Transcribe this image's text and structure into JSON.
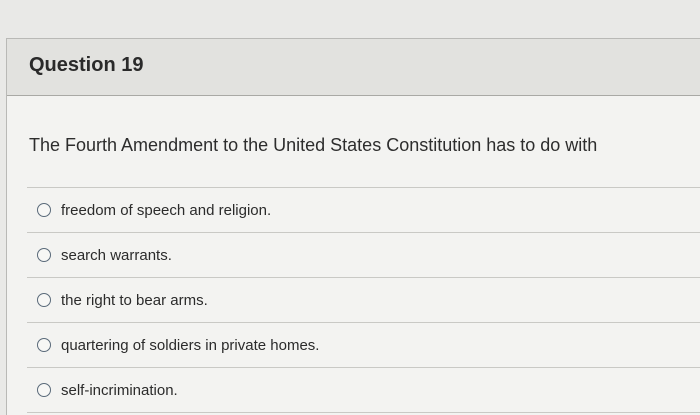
{
  "question": {
    "title": "Question 19",
    "prompt": "The Fourth Amendment to the United States Constitution has to do with"
  },
  "choices": [
    {
      "label": "freedom of speech and religion."
    },
    {
      "label": "search warrants."
    },
    {
      "label": "the right to bear arms."
    },
    {
      "label": "quartering of soldiers in private homes."
    },
    {
      "label": "self-incrimination."
    }
  ]
}
